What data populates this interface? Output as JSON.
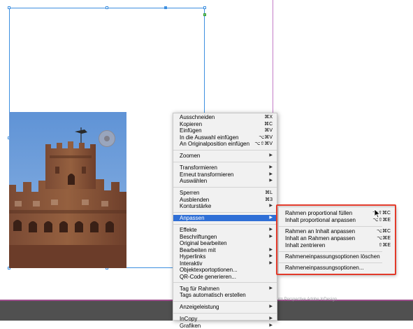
{
  "footer_text": "rm Perspective Adobe InDesign",
  "context_menu": {
    "groups": [
      [
        {
          "label": "Ausschneiden",
          "shortcut": "⌘X"
        },
        {
          "label": "Kopieren",
          "shortcut": "⌘C"
        },
        {
          "label": "Einfügen",
          "shortcut": "⌘V"
        },
        {
          "label": "In die Auswahl einfügen",
          "shortcut": "⌥⌘V"
        },
        {
          "label": "An Originalposition einfügen",
          "shortcut": "⌥⇧⌘V"
        }
      ],
      [
        {
          "label": "Zoomen",
          "submenu": true
        }
      ],
      [
        {
          "label": "Transformieren",
          "submenu": true
        },
        {
          "label": "Erneut transformieren",
          "submenu": true
        },
        {
          "label": "Auswählen",
          "submenu": true
        }
      ],
      [
        {
          "label": "Sperren",
          "shortcut": "⌘L"
        },
        {
          "label": "Ausblenden",
          "shortcut": "⌘3"
        },
        {
          "label": "Konturstärke",
          "submenu": true
        }
      ],
      [
        {
          "label": "Anpassen",
          "submenu": true,
          "highlighted": true
        }
      ],
      [
        {
          "label": "Effekte",
          "submenu": true
        },
        {
          "label": "Beschriftungen",
          "submenu": true
        },
        {
          "label": "Original bearbeiten"
        },
        {
          "label": "Bearbeiten mit",
          "submenu": true
        },
        {
          "label": "Hyperlinks",
          "submenu": true
        },
        {
          "label": "Interaktiv",
          "submenu": true
        },
        {
          "label": "Objektexportoptionen..."
        },
        {
          "label": "QR-Code generieren..."
        }
      ],
      [
        {
          "label": "Tag für Rahmen",
          "submenu": true
        },
        {
          "label": "Tags automatisch erstellen"
        }
      ],
      [
        {
          "label": "Anzeigeleistung",
          "submenu": true
        }
      ],
      [
        {
          "label": "InCopy",
          "submenu": true
        },
        {
          "label": "Grafiken",
          "submenu": true
        }
      ]
    ]
  },
  "submenu": {
    "groups": [
      [
        {
          "label": "Rahmen proportional füllen",
          "shortcut": "⌥⇧⌘C"
        },
        {
          "label": "Inhalt proportional anpassen",
          "shortcut": "⌥⇧⌘E"
        }
      ],
      [
        {
          "label": "Rahmen an Inhalt anpassen",
          "shortcut": "⌥⌘C"
        },
        {
          "label": "Inhalt an Rahmen anpassen",
          "shortcut": "⌥⌘E"
        },
        {
          "label": "Inhalt zentrieren",
          "shortcut": "⇧⌘E"
        }
      ],
      [
        {
          "label": "Rahmeneinpassungsoptionen löschen"
        }
      ],
      [
        {
          "label": "Rahmeneinpassungsoptionen..."
        }
      ]
    ]
  },
  "colors": {
    "selection": "#3d8fe0",
    "menu_highlight": "#2f6fd6",
    "callout": "#e23a2a",
    "page_edge": "#c27bc7"
  }
}
